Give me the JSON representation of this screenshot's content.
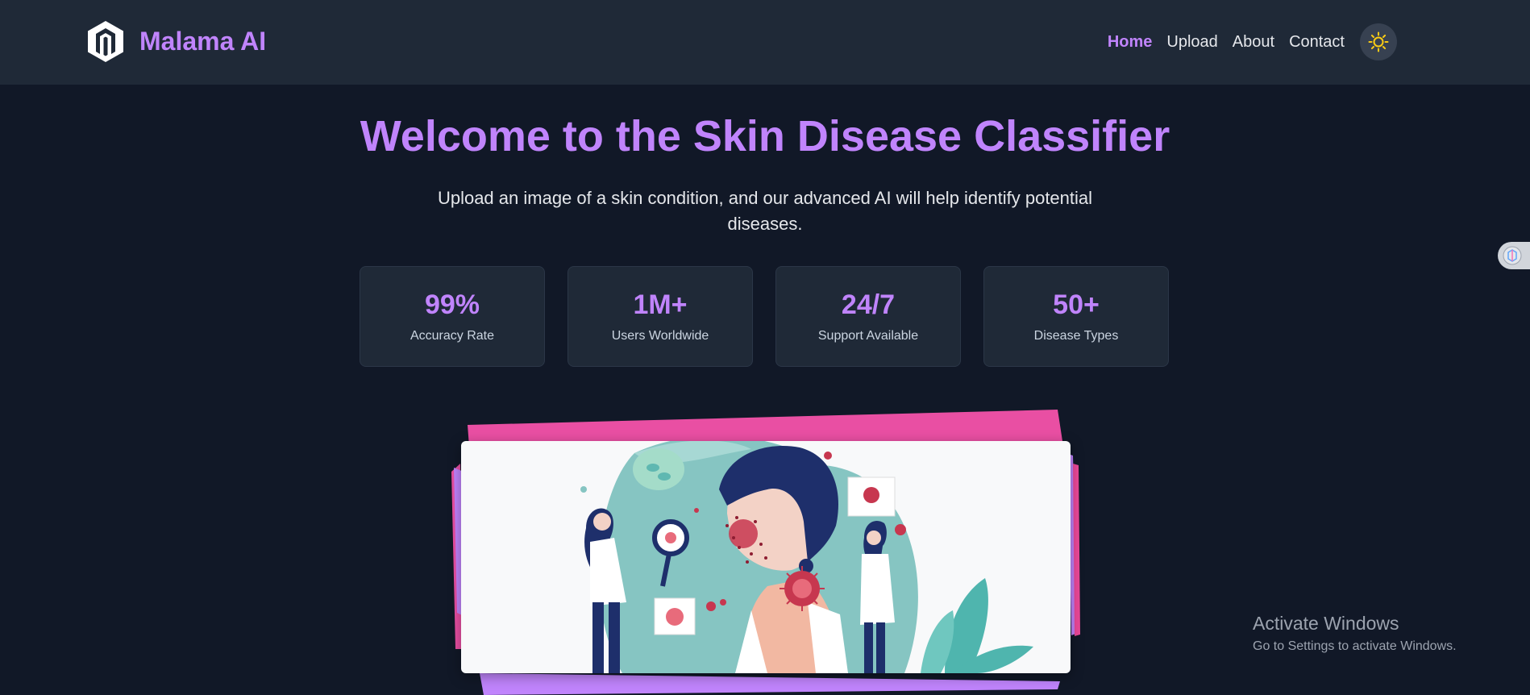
{
  "brand": {
    "name": "Malama AI",
    "logo_icon": "hexagon-m-logo-icon"
  },
  "nav": {
    "links": [
      "Home",
      "Upload",
      "About",
      "Contact"
    ],
    "active": "Home",
    "theme_icon": "sun-icon"
  },
  "hero": {
    "title": "Welcome to the Skin Disease Classifier",
    "subtitle": "Upload an image of a skin condition, and our advanced AI will help identify potential diseases."
  },
  "stats": [
    {
      "value": "99%",
      "label": "Accuracy Rate"
    },
    {
      "value": "1M+",
      "label": "Users Worldwide"
    },
    {
      "value": "24/7",
      "label": "Support Available"
    },
    {
      "value": "50+",
      "label": "Disease Types"
    }
  ],
  "illustration": {
    "icon": "doctors-examining-skin-illustration"
  },
  "side_widget": {
    "icon": "extension-widget-icon"
  },
  "windows_notice": {
    "title": "Activate Windows",
    "subtitle": "Go to Settings to activate Windows."
  },
  "colors": {
    "accent": "#c084fc",
    "background": "#111827",
    "panel": "#1f2937",
    "pink": "#ec4899",
    "purple": "#c084fc",
    "sun": "#facc15"
  }
}
